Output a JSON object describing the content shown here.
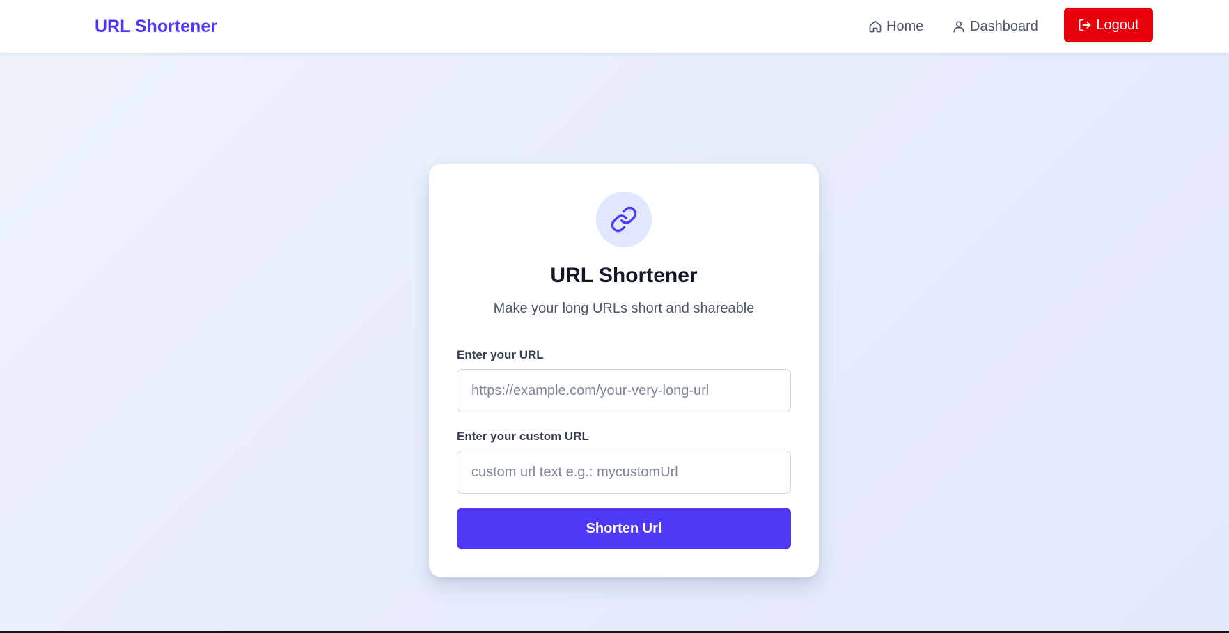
{
  "navbar": {
    "brand": "URL Shortener",
    "links": [
      {
        "label": "Home",
        "icon": "home-icon"
      },
      {
        "label": "Dashboard",
        "icon": "user-icon"
      }
    ],
    "logout": {
      "label": "Logout",
      "icon": "logout-icon"
    }
  },
  "card": {
    "icon": "link-icon",
    "title": "URL Shortener",
    "subtitle": "Make your long URLs short and shareable",
    "fields": {
      "url": {
        "label": "Enter your URL",
        "value": "",
        "placeholder": "https://example.com/your-very-long-url"
      },
      "custom": {
        "label": "Enter your custom URL",
        "value": "",
        "placeholder": "custom url text e.g.: mycustomUrl"
      }
    },
    "submit_label": "Shorten Url"
  },
  "colors": {
    "brand": "#4f39f6",
    "logout": "#e7000b",
    "icon_circle": "#e0e7ff"
  }
}
